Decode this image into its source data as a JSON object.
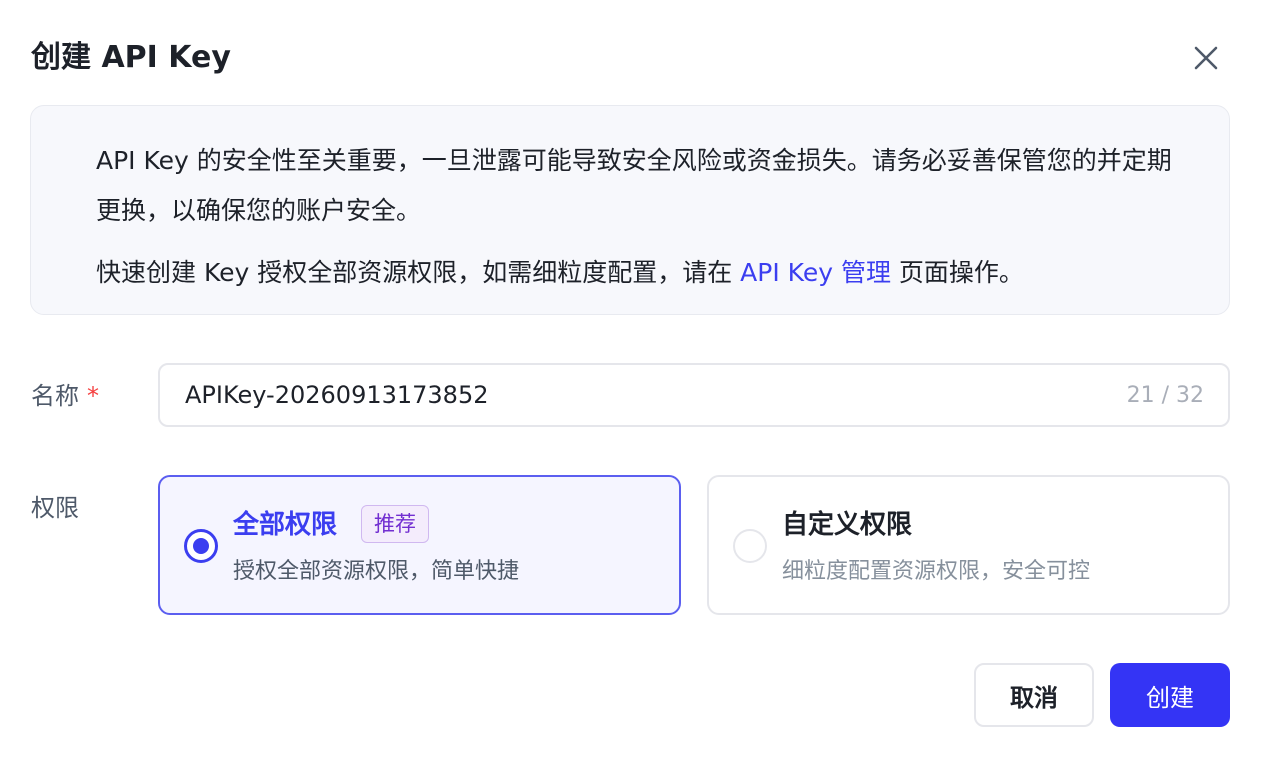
{
  "dialog": {
    "title": "创建 API Key",
    "close_icon": "close-icon"
  },
  "notice": {
    "line1": "API Key 的安全性至关重要，一旦泄露可能导致安全风险或资金损失。请务必妥善保管您的并定期更换，以确保您的账户安全。",
    "line2_prefix": "快速创建 Key 授权全部资源权限，如需细粒度配置，请在 ",
    "line2_link": "API Key 管理",
    "line2_suffix": " 页面操作。"
  },
  "name_field": {
    "label": "名称",
    "required_mark": "*",
    "value": "APIKey-20260913173852",
    "counter": "21 / 32"
  },
  "permission": {
    "label": "权限",
    "options": [
      {
        "title": "全部权限",
        "badge": "推荐",
        "description": "授权全部资源权限，简单快捷",
        "selected": true
      },
      {
        "title": "自定义权限",
        "description": "细粒度配置资源权限，安全可控",
        "selected": false
      }
    ]
  },
  "actions": {
    "cancel_label": "取消",
    "create_label": "创建"
  },
  "colors": {
    "accent": "#3b3ef0",
    "primary_button": "#3434f5",
    "required": "#f53f3f",
    "badge_text": "#722ed1"
  }
}
